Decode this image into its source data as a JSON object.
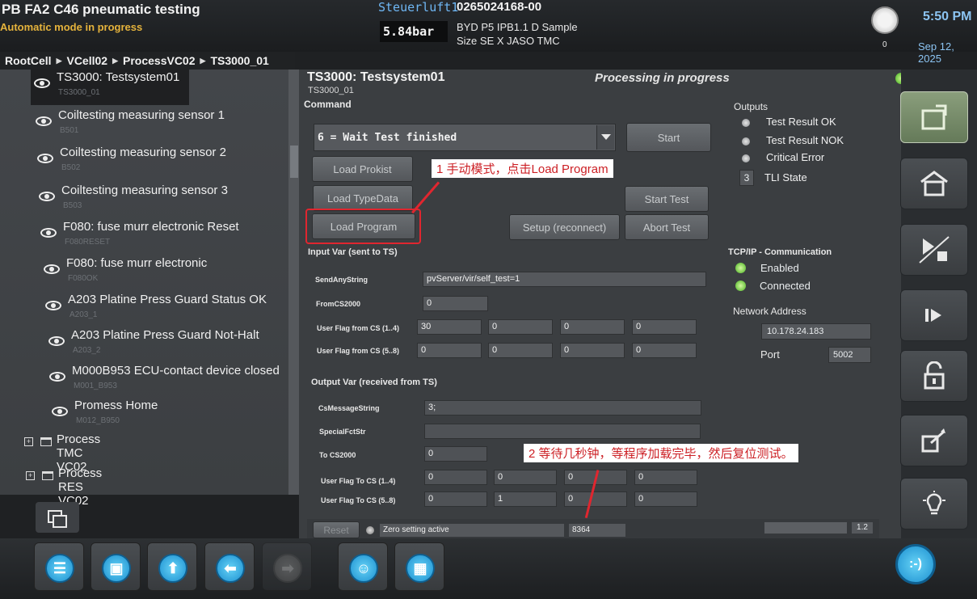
{
  "header": {
    "app_title": "PB FA2 C46 pneumatic testing",
    "mode_status": "Automatic mode in progress",
    "station_label": "Steuerluft1",
    "pressure": "5.84bar",
    "serial": "0265024168-00",
    "product_line1": "BYD P5 IPB1.1 D Sample",
    "product_line2": "Size SE  X JASO TMC",
    "clock_count": "0",
    "time": "5:50 PM",
    "date": "Sep 12, 2025"
  },
  "breadcrumb": [
    "RootCell",
    "VCell02",
    "ProcessVC02",
    "TS3000_01"
  ],
  "tree": {
    "items": [
      {
        "label": "TS3000: Testsystem01",
        "sub": "TS3000_01"
      },
      {
        "label": "Coiltesting measuring sensor 1",
        "sub": "B501"
      },
      {
        "label": "Coiltesting measuring sensor 2",
        "sub": "B502"
      },
      {
        "label": "Coiltesting measuring sensor 3",
        "sub": "B503"
      },
      {
        "label": "F080: fuse murr electronic Reset",
        "sub": "F080RESET"
      },
      {
        "label": "F080: fuse murr electronic",
        "sub": "F080OK"
      },
      {
        "label": "A203 Platine Press Guard Status OK",
        "sub": "A203_1"
      },
      {
        "label": "A203 Platine Press Guard Not-Halt",
        "sub": "A203_2"
      },
      {
        "label": "M000B953 ECU-contact device closed",
        "sub": "M001_B953"
      },
      {
        "label": "Promess Home",
        "sub": "M012_B950"
      }
    ],
    "folders": [
      {
        "label": "Process TMC VC02"
      },
      {
        "label": "Process RES VC02"
      }
    ]
  },
  "main": {
    "title": "TS3000: Testsystem01",
    "subtitle": "TS3000_01",
    "processing": "Processing in progress",
    "command_label": "Command",
    "command_value": "6 = Wait Test finished",
    "buttons": {
      "start": "Start",
      "load_prokist": "Load Prokist",
      "load_typedata": "Load TypeData",
      "start_test": "Start Test",
      "load_program": "Load Program",
      "setup": "Setup (reconnect)",
      "abort_test": "Abort Test"
    },
    "input_var": {
      "label": "Input Var (sent to TS)",
      "send_any_string_label": "SendAnyString",
      "send_any_string": "pvServer/vir/self_test=1",
      "from_cs2000_label": "FromCS2000",
      "from_cs2000": "0",
      "flags1_label": "User Flag from CS (1..4)",
      "flags1": [
        "30",
        "0",
        "0",
        "0"
      ],
      "flags2_label": "User Flag from CS (5..8)",
      "flags2": [
        "0",
        "0",
        "0",
        "0"
      ]
    },
    "output_var": {
      "label": "Output Var (received from TS)",
      "cs_message_label": "CsMessageString",
      "cs_message": "3;",
      "special_label": "SpecialFctStr",
      "special": "",
      "to_cs2000_label": "To CS2000",
      "to_cs2000": "0",
      "flags1_label": "User Flag To CS (1..4)",
      "flags1": [
        "0",
        "0",
        "0",
        "0"
      ],
      "flags2_label": "User Flag To CS (5..8)",
      "flags2": [
        "0",
        "1",
        "0",
        "0"
      ]
    },
    "annotations": {
      "callout1": "1 手动模式，点击Load  Program",
      "callout2": "2 等待几秒钟，等程序加载完毕，然后复位测试。"
    }
  },
  "outputs": {
    "label": "Outputs",
    "items": [
      "Test Result OK",
      "Test Result NOK",
      "Critical Error"
    ],
    "tli_value": "3",
    "tli_label": "TLI State"
  },
  "tcp": {
    "label": "TCP/IP - Communication",
    "enabled": "Enabled",
    "connected": "Connected",
    "network_label": "Network Address",
    "address": "10.178.24.183",
    "port_label": "Port",
    "port": "5002"
  },
  "status_bar": {
    "reset": "Reset",
    "zero_setting": "Zero setting active",
    "counter": "8364",
    "version": "1.2"
  },
  "colors": {
    "accent_blue": "#1b8fd0",
    "highlight_red": "#e0262f",
    "status_green": "#49b320",
    "mode_amber": "#e5b33c"
  }
}
